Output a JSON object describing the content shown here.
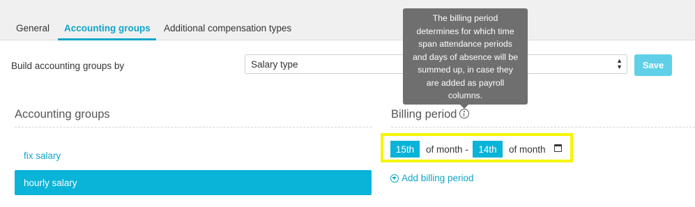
{
  "tabs": [
    {
      "label": "General"
    },
    {
      "label": "Accounting groups",
      "active": true
    },
    {
      "label": "Additional compensation types"
    }
  ],
  "build": {
    "label": "Build accounting groups by",
    "select_value": "Salary type",
    "save_label": "Save"
  },
  "accounting_groups": {
    "heading": "Accounting groups",
    "items": [
      {
        "label": "fix salary"
      },
      {
        "label": "hourly salary",
        "selected": true
      }
    ]
  },
  "billing": {
    "heading": "Billing period",
    "tooltip_lines": [
      "The billing period",
      "determines for which time",
      "span attendance periods",
      "and days of absence will be",
      "summed up, in case they",
      "are added as payroll",
      "columns."
    ],
    "start_day": "15th",
    "of_month_dash": "of month -",
    "end_day": "14th",
    "of_month": "of month",
    "add_label": "Add billing period"
  },
  "colors": {
    "accent": "#0ab3d8",
    "save_button": "#5fd0e8",
    "tooltip_bg": "#6f6f6f",
    "highlight": "#f5f500"
  },
  "icons": {
    "info": "info-circle-icon",
    "calendar": "calendar-icon",
    "add": "plus-circle-icon",
    "select": "updown-arrows-icon"
  }
}
